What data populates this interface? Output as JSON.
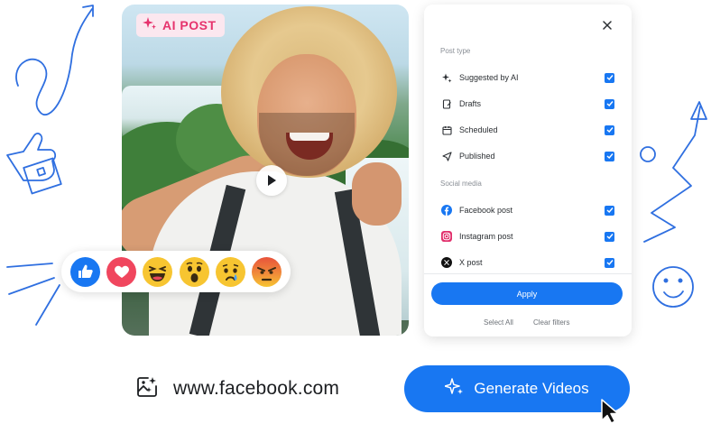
{
  "badge": {
    "label": "AI POST",
    "icon": "sparkle-icon"
  },
  "reactions": [
    {
      "name": "like",
      "icon": "thumbs-up-icon"
    },
    {
      "name": "love",
      "icon": "heart-icon"
    },
    {
      "name": "haha",
      "icon": "laughing-face-icon"
    },
    {
      "name": "wow",
      "icon": "surprised-face-icon"
    },
    {
      "name": "sad",
      "icon": "crying-face-icon"
    },
    {
      "name": "angry",
      "icon": "angry-face-icon"
    }
  ],
  "filters": {
    "post_type_title": "Post type",
    "post_types": [
      {
        "label": "Suggested by AI",
        "icon": "sparkle-icon",
        "checked": true
      },
      {
        "label": "Drafts",
        "icon": "draft-icon",
        "checked": true
      },
      {
        "label": "Scheduled",
        "icon": "calendar-icon",
        "checked": true
      },
      {
        "label": "Published",
        "icon": "send-icon",
        "checked": true
      }
    ],
    "social_media_title": "Social media",
    "social_media": [
      {
        "label": "Facebook post",
        "icon": "facebook-icon",
        "checked": true
      },
      {
        "label": "Instagram post",
        "icon": "instagram-icon",
        "checked": true
      },
      {
        "label": "X post",
        "icon": "x-icon",
        "checked": true
      }
    ],
    "apply_label": "Apply",
    "select_all_label": "Select All",
    "clear_filters_label": "Clear filters"
  },
  "url": {
    "text": "www.facebook.com",
    "icon": "ai-image-icon"
  },
  "generate_button": {
    "label": "Generate Videos",
    "icon": "sparkle-icon"
  },
  "colors": {
    "accent": "#1877f2",
    "badge_pink": "#e6336d",
    "doodle_blue": "#2f6fe0"
  }
}
